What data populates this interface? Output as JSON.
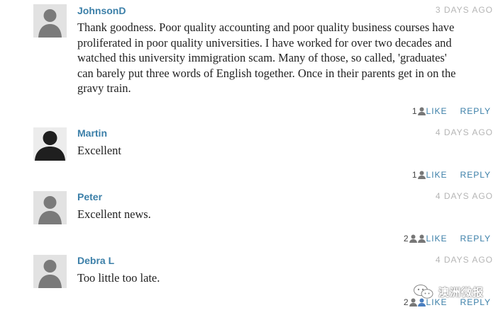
{
  "comments": [
    {
      "author": "JohnsonD",
      "time": "3 DAYS AGO",
      "lines": [
        "Thank goodness. Poor quality accounting and poor quality business courses have",
        "proliferated in poor quality universities. I have worked for over two decades and",
        "watched this university immigration scam. Many of those, so called, 'graduates'",
        "can barely put three words of English together. Once in their parents get in on the",
        "gravy train."
      ],
      "likes": "1",
      "like_label": "LIKE",
      "reply_label": "REPLY"
    },
    {
      "author": "Martin",
      "time": "4 DAYS AGO",
      "lines": [
        "Excellent"
      ],
      "likes": "1",
      "like_label": "LIKE",
      "reply_label": "REPLY"
    },
    {
      "author": "Peter",
      "time": "4 DAYS AGO",
      "lines": [
        "Excellent news."
      ],
      "likes": "2",
      "like_label": "LIKE",
      "reply_label": "REPLY"
    },
    {
      "author": "Debra L",
      "time": "4 DAYS AGO",
      "lines": [
        "Too little too late."
      ],
      "likes": "2",
      "like_label": "LIKE",
      "reply_label": "REPLY"
    }
  ],
  "watermark": {
    "text": "澳洲微报"
  },
  "colors": {
    "link": "#3b7fa8",
    "timestamp": "#b5b5b5",
    "avatar_bg": "#e2e2e2"
  },
  "icons": {
    "avatar": "person-silhouette-icon",
    "like": "person-icon",
    "watermark": "wechat-logo-icon"
  }
}
